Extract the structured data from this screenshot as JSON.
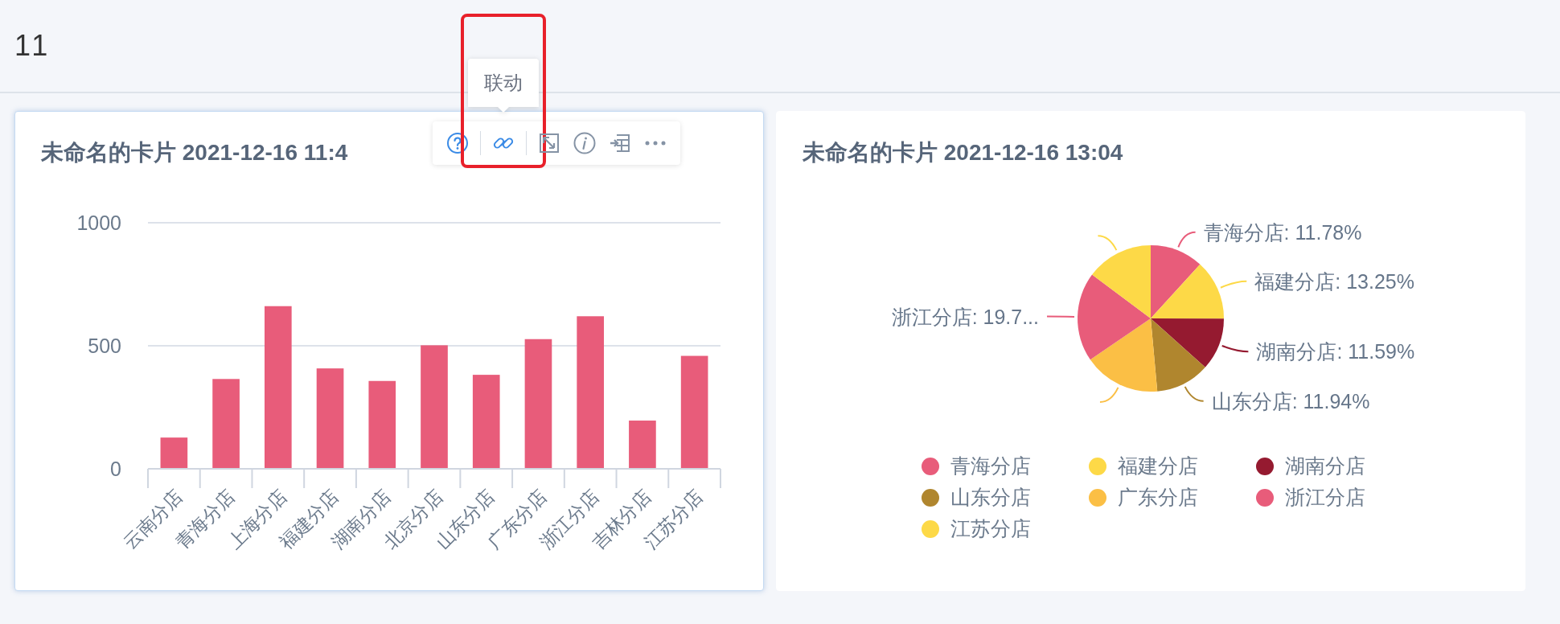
{
  "header": {
    "title": "11"
  },
  "cards": [
    {
      "selected": true,
      "title": "未命名的卡片 2021-12-16 11:4",
      "toolbar": {
        "tooltip": "联动",
        "buttons": [
          {
            "kind": "help",
            "hovered": false
          },
          {
            "kind": "link",
            "hovered": true
          },
          {
            "kind": "expand",
            "hovered": false
          },
          {
            "kind": "info",
            "hovered": false
          },
          {
            "kind": "export",
            "hovered": false
          },
          {
            "kind": "more",
            "hovered": false
          }
        ]
      },
      "chart_data": {
        "type": "bar",
        "categories": [
          "云南分店",
          "青海分店",
          "上海分店",
          "福建分店",
          "湖南分店",
          "北京分店",
          "山东分店",
          "广东分店",
          "浙江分店",
          "吉林分店",
          "江苏分店"
        ],
        "series": [
          {
            "color": "#e85c7a",
            "values": [
              127,
              365,
              661,
              408,
              357,
              502,
              382,
              527,
              620,
              196,
              459
            ]
          }
        ],
        "ylim": [
          0,
          1000
        ],
        "yticks": [
          0,
          500,
          1000
        ]
      }
    },
    {
      "selected": false,
      "title": "未命名的卡片 2021-12-16 13:04",
      "chart_data": {
        "type": "pie",
        "categories": [
          "青海分店",
          "福建分店",
          "湖南分店",
          "山东分店",
          "广东分店",
          "浙江分店",
          "江苏分店"
        ],
        "values": [
          11.78,
          13.25,
          11.59,
          11.94,
          16.9,
          19.74,
          14.8
        ],
        "colors": [
          "#e85c7a",
          "#fdd947",
          "#951a30",
          "#b0862e",
          "#fbbf45",
          "#e85c7a",
          "#fdd947"
        ],
        "value_labels": [
          "青海分店: 11.78%",
          "福建分店: 13.25%",
          "湖南分店: 11.59%",
          "山东分店: 11.94%",
          null,
          "浙江分店: 19.7...",
          null
        ]
      }
    }
  ]
}
